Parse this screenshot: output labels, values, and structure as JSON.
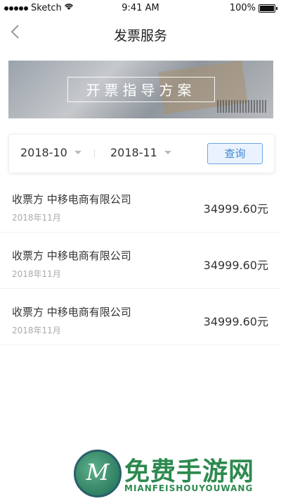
{
  "status_bar": {
    "carrier": "Sketch",
    "time": "9:41 AM",
    "battery": "100%"
  },
  "nav": {
    "title": "发票服务"
  },
  "banner": {
    "text": "开票指导方案"
  },
  "filter": {
    "start_month": "2018-10",
    "end_month": "2018-11",
    "query_label": "查询"
  },
  "invoices": [
    {
      "title": "收票方 中移电商有限公司",
      "date": "2018年11月",
      "amount": "34999.60元"
    },
    {
      "title": "收票方 中移电商有限公司",
      "date": "2018年11月",
      "amount": "34999.60元"
    },
    {
      "title": "收票方 中移电商有限公司",
      "date": "2018年11月",
      "amount": "34999.60元"
    }
  ],
  "watermark": {
    "logo_letter": "M",
    "title": "免费手游网",
    "subtitle": "MIANFEISHOUYOUWANG"
  }
}
